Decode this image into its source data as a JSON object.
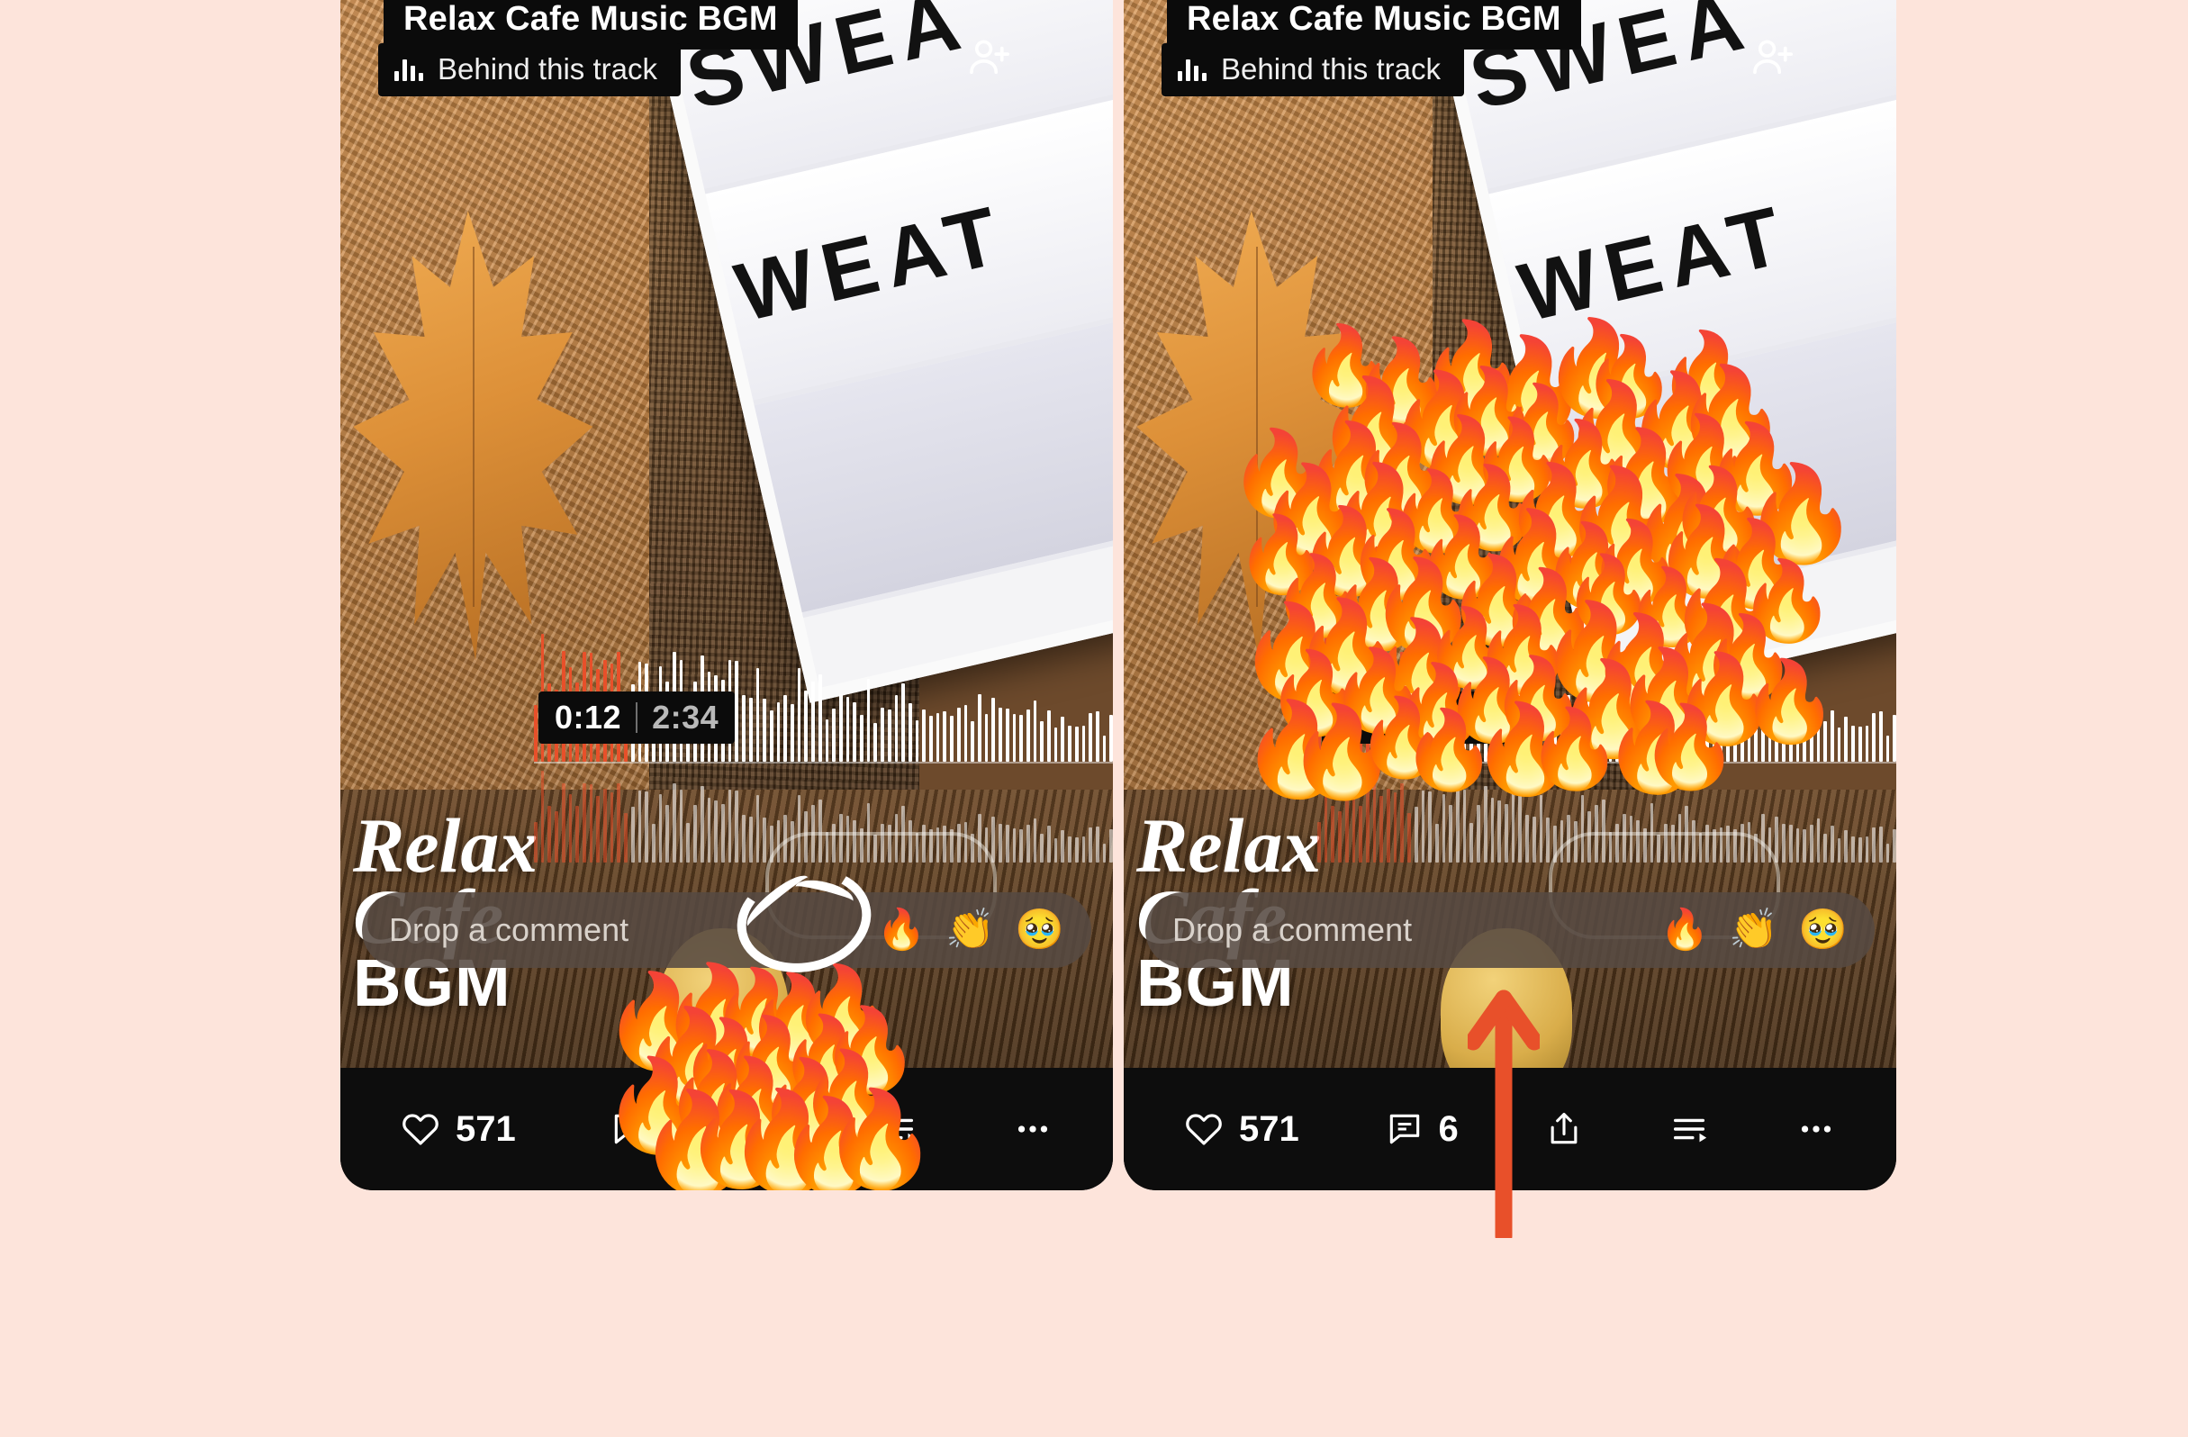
{
  "page": {
    "background_color": "#fde4db",
    "accent_color": "#e8502a",
    "annotation_circle_color": "#ffffff"
  },
  "track": {
    "title": "Relax Cafe Music BGM",
    "behind_label": "Behind this track",
    "behind_icon": "audio-wave-icon",
    "follow_icon": "person-add-icon",
    "overlay_title_line1": "Relax",
    "overlay_title_line2": "Cafe",
    "overlay_title_line3": "BGM"
  },
  "photo": {
    "sign_line1": "SWEA",
    "sign_line2": "WEAT",
    "description_alt": "autumn knit sweater, maple leaf and lightbox sign"
  },
  "player": {
    "elapsed": "0:12",
    "total": "2:34",
    "separator": "|",
    "played_bars": 14,
    "total_bars": 84
  },
  "comment_bar": {
    "placeholder": "Drop a comment",
    "quick_reactions": [
      "🔥",
      "👏",
      "🥹"
    ],
    "quick_reaction_names": [
      "fire-emoji",
      "clapping-hands-emoji",
      "pleading-face-emoji"
    ]
  },
  "actions": {
    "like_icon": "heart-icon",
    "like_count": "571",
    "comment_icon": "comment-bubble-icon",
    "comment_count": "6",
    "share_icon": "share-upload-icon",
    "queue_icon": "add-to-queue-icon",
    "more_icon": "more-horizontal-icon"
  },
  "annotations": {
    "circle_target": "fire-emoji quick reaction",
    "arrow_target": "comment bar",
    "arrow_color": "#e8502a"
  },
  "reaction_burst": {
    "emoji": "🔥",
    "left_panel_count": 18,
    "right_panel_count": 62
  }
}
